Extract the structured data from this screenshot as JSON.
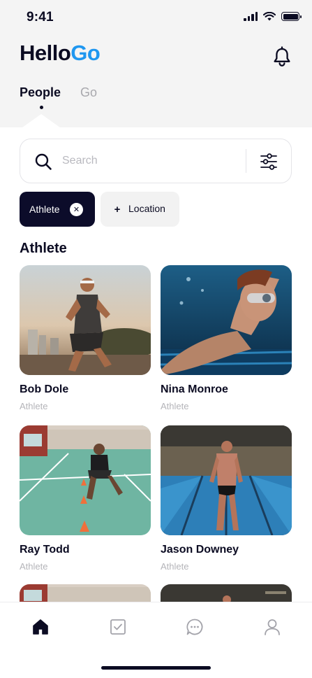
{
  "status_bar": {
    "time": "9:41"
  },
  "app": {
    "logo_part1": "Hello",
    "logo_part2": "Go",
    "accent_color": "#1f97f0"
  },
  "tabs": [
    {
      "label": "People",
      "active": true
    },
    {
      "label": "Go",
      "active": false
    }
  ],
  "search": {
    "placeholder": "Search"
  },
  "filters": {
    "active_chip": {
      "label": "Athlete"
    },
    "add_chip": {
      "label": "Location",
      "icon": "+"
    }
  },
  "section": {
    "title": "Athlete"
  },
  "people": [
    {
      "name": "Bob Dole",
      "role": "Athlete"
    },
    {
      "name": "Nina Monroe",
      "role": "Athlete"
    },
    {
      "name": "Ray Todd",
      "role": "Athlete"
    },
    {
      "name": "Jason Downey",
      "role": "Athlete"
    }
  ],
  "bottom_nav": {
    "items": [
      {
        "icon": "home-icon",
        "active": true
      },
      {
        "icon": "checkbox-icon",
        "active": false
      },
      {
        "icon": "chat-icon",
        "active": false
      },
      {
        "icon": "profile-icon",
        "active": false
      }
    ]
  }
}
